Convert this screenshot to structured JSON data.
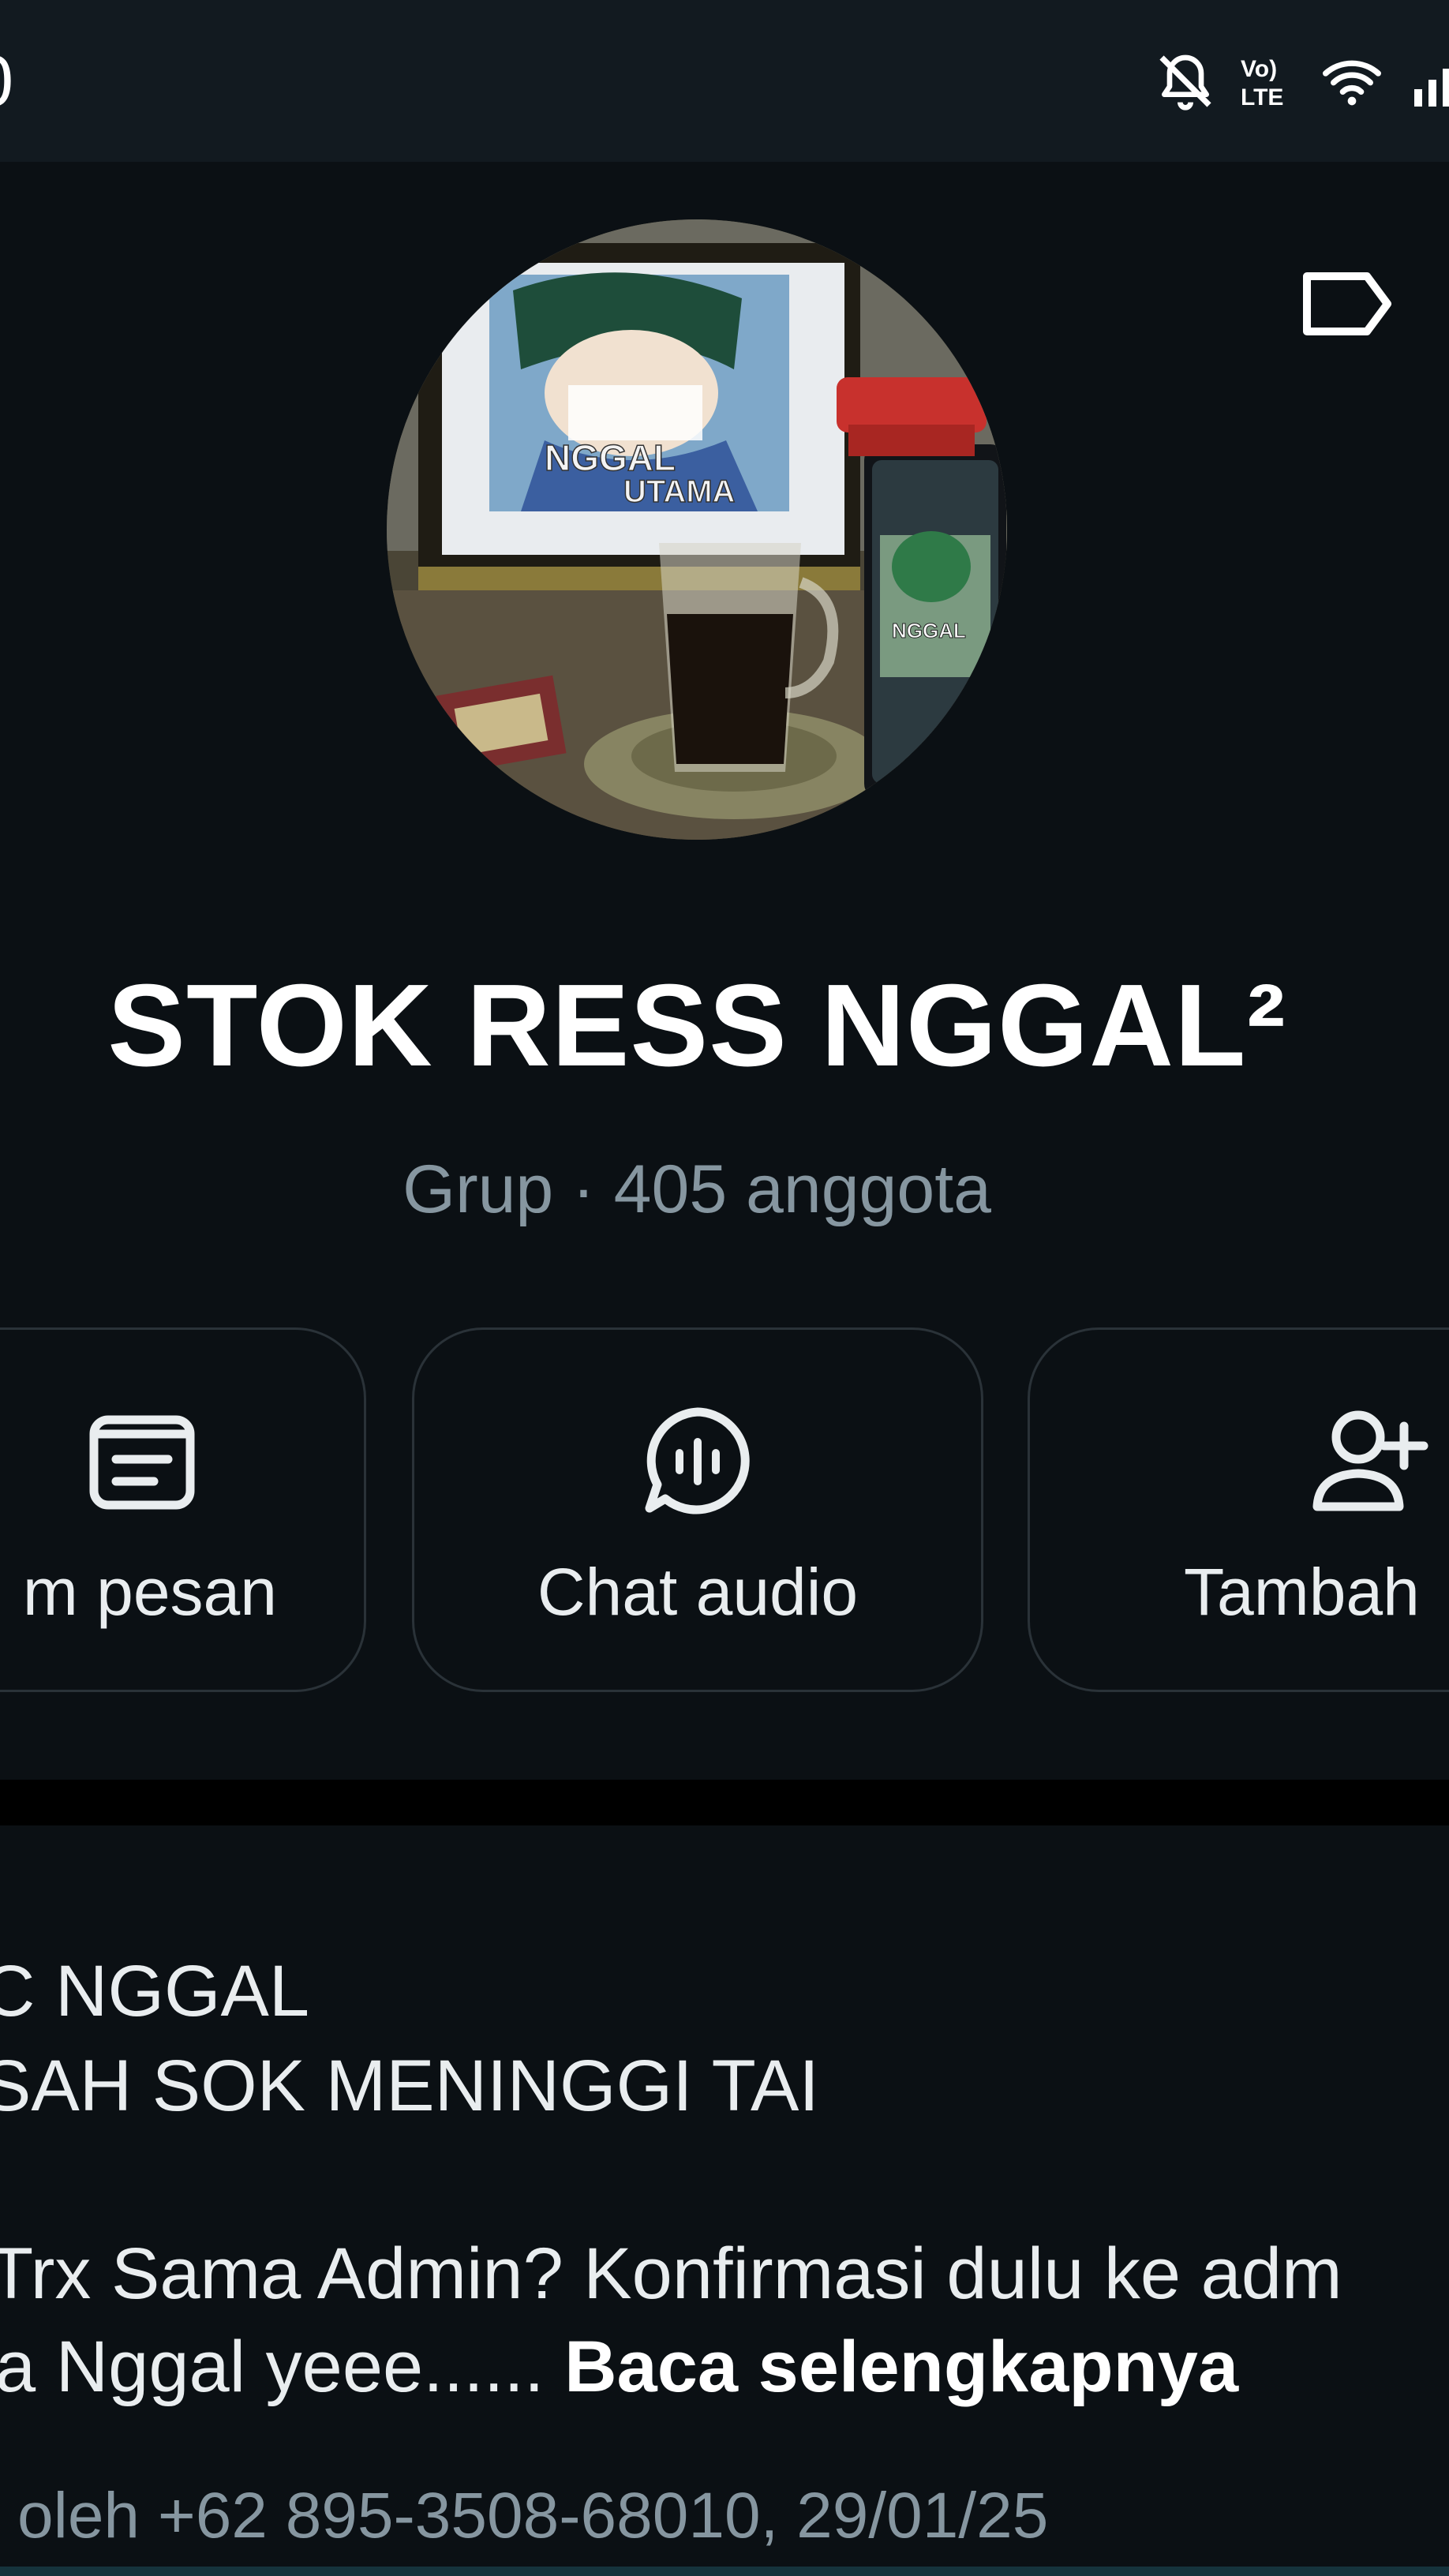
{
  "status_bar": {
    "time": "0",
    "icons": [
      "bell-off-icon",
      "volte-icon",
      "wifi-icon",
      "signal-icon"
    ],
    "volte_text_top": "Vo)",
    "volte_text_bottom": "LTE"
  },
  "header": {
    "label_icon": "label-tag-icon"
  },
  "group": {
    "name": "STOK RESS NGGAL²",
    "subtitle": "Grup · 405 anggota",
    "avatar_icon": "group-avatar-photo"
  },
  "avatar_image": {
    "poster_text_line1": "NGGAL",
    "poster_text_line2": "UTAMA",
    "phone_text": "NGGAL"
  },
  "actions": [
    {
      "label": "m pesan",
      "icon": "message-search-icon"
    },
    {
      "label": "Chat audio",
      "icon": "audio-chat-icon"
    },
    {
      "label": "Tambah",
      "icon": "add-person-icon"
    }
  ],
  "description": {
    "line1": "C NGGAL",
    "line2": "SAH SOK MENINGGI TAI",
    "line3": "Trx Sama Admin? Konfirmasi dulu ke adm",
    "line4_text": "a Nggal yeee......",
    "read_more": "Baca selengkapnya",
    "meta": "oleh +62 895-3508-68010, 29/01/25"
  },
  "colors": {
    "background": "#0b1014",
    "status_bar": "#121a20",
    "primary_text": "#e9edef",
    "secondary_text": "#8696a0",
    "button_border": "#2a3238",
    "divider": "#000000"
  }
}
